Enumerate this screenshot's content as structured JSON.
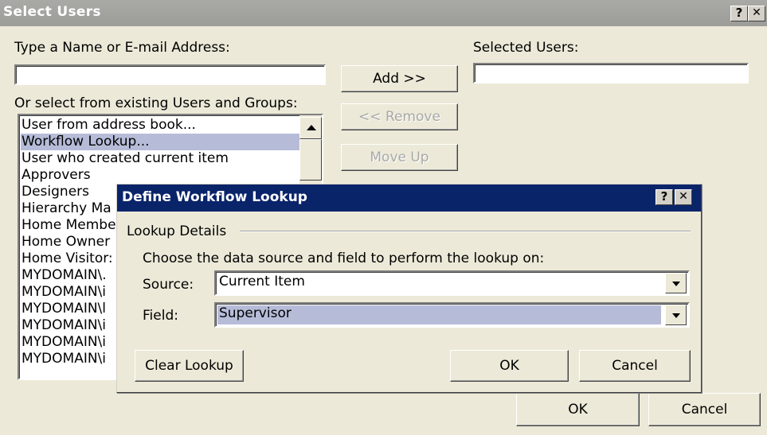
{
  "outer_dialog": {
    "title": "Select Users",
    "help_glyph": "?",
    "close_glyph": "✕",
    "name_label": "Type a Name or E-mail Address:",
    "name_value": "",
    "existing_label": "Or select from existing Users and Groups:",
    "selected_label": "Selected Users:",
    "selected_value": "",
    "buttons": {
      "add": "Add >>",
      "remove": "<< Remove",
      "move_up": "Move Up",
      "ok": "OK",
      "cancel": "Cancel"
    },
    "list_items": [
      "User from address book...",
      "Workflow Lookup...",
      "User who created current item",
      "Approvers",
      "Designers",
      "Hierarchy Ma",
      "Home Membe",
      "Home Owner",
      "Home Visitor:",
      "MYDOMAIN\\.",
      "MYDOMAIN\\i",
      "MYDOMAIN\\l",
      "MYDOMAIN\\i",
      "MYDOMAIN\\i",
      "MYDOMAIN\\i"
    ],
    "selected_list_item": "Workflow Lookup..."
  },
  "inner_dialog": {
    "title": "Define Workflow Lookup",
    "help_glyph": "?",
    "close_glyph": "✕",
    "group_label": "Lookup Details",
    "instruction": "Choose the data source and field to perform the lookup on:",
    "source_label": "Source:",
    "source_value": "Current Item",
    "field_label": "Field:",
    "field_value": "Supervisor",
    "buttons": {
      "clear": "Clear Lookup",
      "ok": "OK",
      "cancel": "Cancel"
    }
  },
  "colors": {
    "outer_title_bar": "#a0a09c",
    "inner_title_bar": "#0a246a",
    "selection_highlight": "#b6bcd8",
    "dialog_face": "#ece9d8"
  }
}
